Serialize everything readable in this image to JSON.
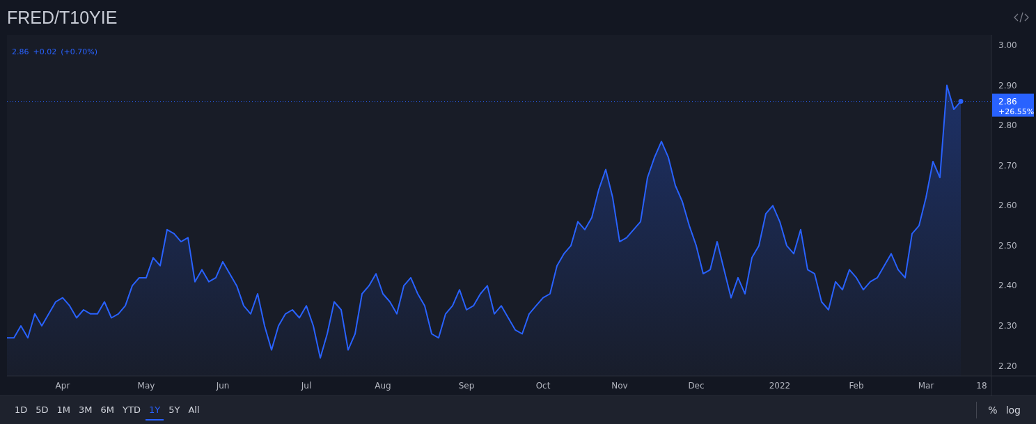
{
  "header": {
    "title": "FRED/T10YIE"
  },
  "legend": {
    "price": "2.86",
    "change": "+0.02",
    "change_percent": "(+0.70%)"
  },
  "chart": {
    "last_change": "+26.55%",
    "chart_data": {
      "type": "area",
      "ref_lines": [
        {
          "axis": "y",
          "value": 2.86,
          "label": "2.86"
        }
      ],
      "categories": [
        null,
        null,
        null,
        null,
        null,
        null,
        null,
        null,
        "Apr",
        null,
        null,
        null,
        null,
        null,
        null,
        null,
        null,
        null,
        null,
        null,
        "May",
        null,
        null,
        null,
        null,
        null,
        null,
        null,
        null,
        null,
        null,
        "Jun",
        null,
        null,
        null,
        null,
        null,
        null,
        null,
        null,
        null,
        null,
        null,
        "Jul",
        null,
        null,
        null,
        null,
        null,
        null,
        null,
        null,
        null,
        null,
        "Aug",
        null,
        null,
        null,
        null,
        null,
        null,
        null,
        null,
        null,
        null,
        null,
        "Sep",
        null,
        null,
        null,
        null,
        null,
        null,
        null,
        null,
        null,
        null,
        "Oct",
        null,
        null,
        null,
        null,
        null,
        null,
        null,
        null,
        null,
        null,
        "Nov",
        null,
        null,
        null,
        null,
        null,
        null,
        null,
        null,
        null,
        null,
        "Dec",
        null,
        null,
        null,
        null,
        null,
        null,
        null,
        null,
        null,
        null,
        null,
        "2022",
        null,
        null,
        null,
        null,
        null,
        null,
        null,
        null,
        null,
        null,
        "Feb",
        null,
        null,
        null,
        null,
        null,
        null,
        null,
        null,
        null,
        "Mar",
        null,
        null,
        null,
        null,
        null,
        null,
        null,
        "18"
      ],
      "ylim": [
        2.175,
        3.026
      ],
      "yticks": [
        {
          "value": 3.0,
          "label": "3.00"
        },
        {
          "value": 2.9,
          "label": "2.90"
        },
        {
          "value": 2.8,
          "label": "2.80"
        },
        {
          "value": 2.7,
          "label": "2.70"
        },
        {
          "value": 2.6,
          "label": "2.60"
        },
        {
          "value": 2.5,
          "label": "2.50"
        },
        {
          "value": 2.4,
          "label": "2.40"
        },
        {
          "value": 2.3,
          "label": "2.30"
        },
        {
          "value": 2.2,
          "label": "2.20"
        }
      ],
      "series": [
        {
          "color": "#2962ff",
          "values": [
            2.27,
            2.27,
            2.3,
            2.27,
            2.33,
            2.3,
            2.33,
            2.36,
            2.37,
            2.35,
            2.32,
            2.34,
            2.33,
            2.33,
            2.36,
            2.32,
            2.33,
            2.35,
            2.4,
            2.42,
            2.42,
            2.47,
            2.45,
            2.54,
            2.53,
            2.51,
            2.52,
            2.41,
            2.44,
            2.41,
            2.42,
            2.46,
            2.43,
            2.4,
            2.35,
            2.33,
            2.38,
            2.3,
            2.24,
            2.3,
            2.33,
            2.34,
            2.32,
            2.35,
            2.3,
            2.22,
            2.28,
            2.36,
            2.34,
            2.24,
            2.28,
            2.38,
            2.4,
            2.43,
            2.38,
            2.36,
            2.33,
            2.4,
            2.42,
            2.38,
            2.35,
            2.28,
            2.27,
            2.33,
            2.35,
            2.39,
            2.34,
            2.35,
            2.38,
            2.4,
            2.33,
            2.35,
            2.32,
            2.29,
            2.28,
            2.33,
            2.35,
            2.37,
            2.38,
            2.45,
            2.48,
            2.5,
            2.56,
            2.54,
            2.57,
            2.64,
            2.69,
            2.62,
            2.51,
            2.52,
            2.54,
            2.56,
            2.67,
            2.72,
            2.76,
            2.72,
            2.65,
            2.61,
            2.55,
            2.5,
            2.43,
            2.44,
            2.51,
            2.44,
            2.37,
            2.42,
            2.38,
            2.47,
            2.5,
            2.58,
            2.6,
            2.56,
            2.5,
            2.48,
            2.54,
            2.44,
            2.43,
            2.36,
            2.34,
            2.41,
            2.39,
            2.44,
            2.42,
            2.39,
            2.41,
            2.42,
            2.45,
            2.48,
            2.44,
            2.42,
            2.53,
            2.55,
            2.62,
            2.71,
            2.67,
            2.9,
            2.84,
            2.86,
            null,
            null,
            null
          ]
        }
      ]
    }
  },
  "range_buttons": [
    {
      "label": "1D",
      "selected": false
    },
    {
      "label": "5D",
      "selected": false
    },
    {
      "label": "1M",
      "selected": false
    },
    {
      "label": "3M",
      "selected": false
    },
    {
      "label": "6M",
      "selected": false
    },
    {
      "label": "YTD",
      "selected": false
    },
    {
      "label": "1Y",
      "selected": true
    },
    {
      "label": "5Y",
      "selected": false
    },
    {
      "label": "All",
      "selected": false
    }
  ],
  "scale_buttons": [
    {
      "label": "%"
    },
    {
      "label": "log"
    }
  ]
}
